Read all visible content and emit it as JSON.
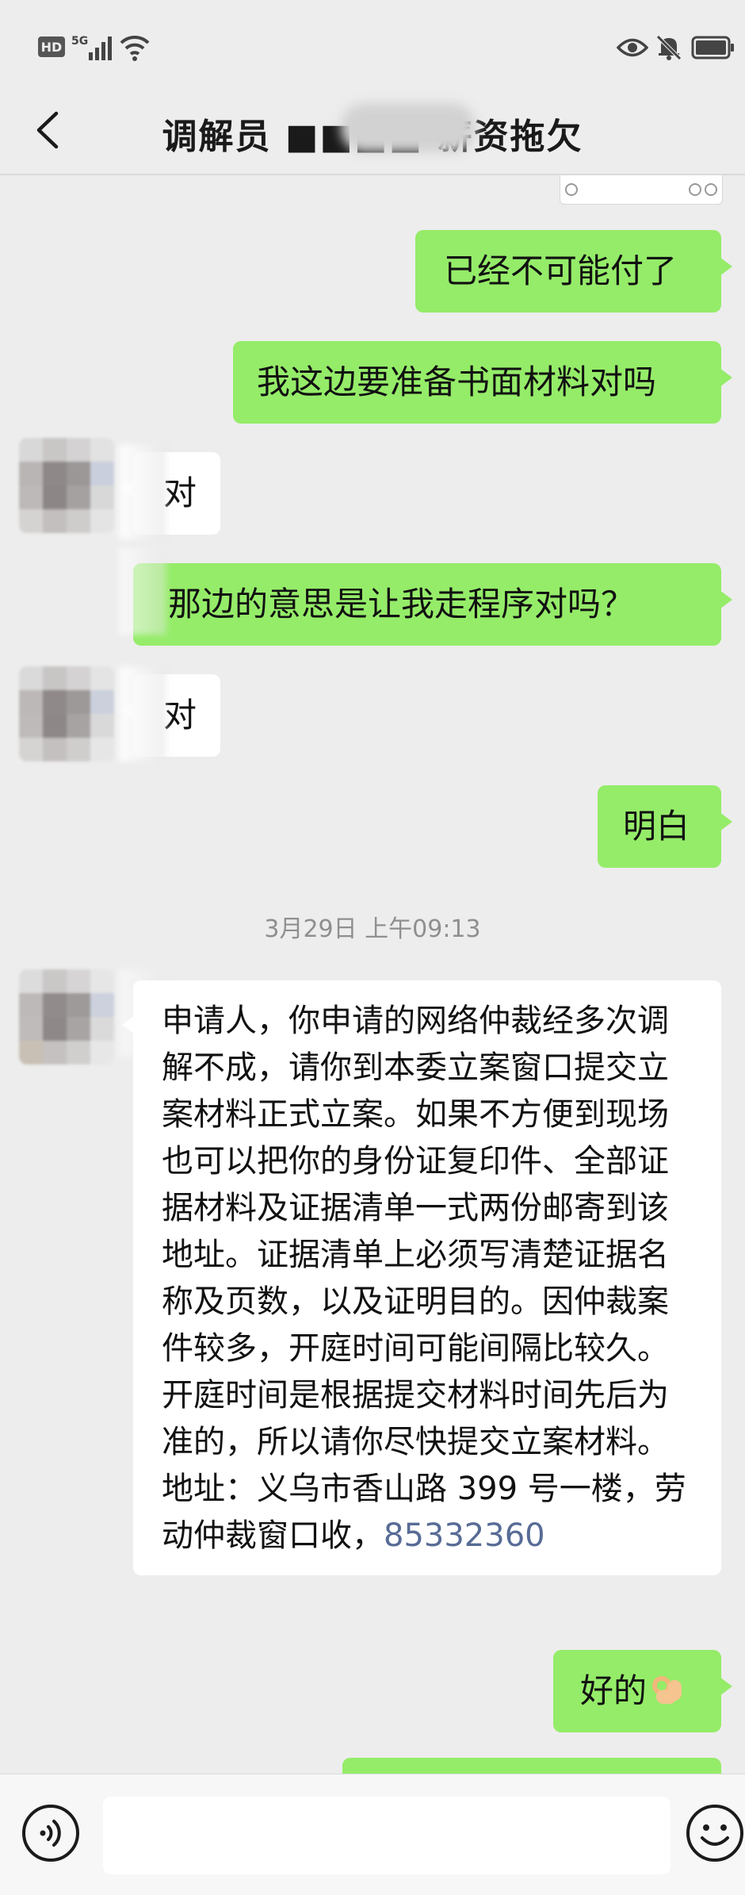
{
  "status_bar": {
    "hd_label": "HD",
    "network_label": "5G",
    "icons": [
      "hd-badge",
      "5g-signal-icon",
      "wifi-icon",
      "eye-icon",
      "mute-bell-icon",
      "battery-icon"
    ]
  },
  "header": {
    "title": "调解员 ■■■■ 薪资拖欠",
    "back_icon": "chevron-left-icon"
  },
  "messages": [
    {
      "side": "out",
      "text": "已经不可能付了"
    },
    {
      "side": "out",
      "text": "我这边要准备书面材料对吗"
    },
    {
      "side": "in",
      "text": "对"
    },
    {
      "side": "out",
      "text": "那边的意思是让我走程序对吗？"
    },
    {
      "side": "in",
      "text": "对"
    },
    {
      "side": "out",
      "text": "明白"
    },
    {
      "side": "in",
      "text": "申请人，你申请的网络仲裁经多次调解不成，请你到本委立案窗口提交立案材料正式立案。如果不方便到现场也可以把你的身份证复印件、全部证据材料及证据清单一式两份邮寄到该地址。证据清单上必须写清楚证据名称及页数，以及证明目的。因仲裁案件较多，开庭时间可能间隔比较久。开庭时间是根据提交材料时间先后为准的，所以请你尽快提交立案材料。地址：义乌市香山路 399 号一楼，劳动仲裁窗口收，",
      "phone": "85332360"
    },
    {
      "side": "out",
      "text": "好的",
      "emoji": "ok-hand-emoji"
    }
  ],
  "timestamp": "3月29日 上午09:13",
  "input_bar": {
    "voice_icon": "voice-input-icon",
    "text_value": "",
    "emoji_icon": "emoji-smiley-icon"
  },
  "colors": {
    "background": "#ededed",
    "outgoing_bubble": "#95ec69",
    "incoming_bubble": "#ffffff",
    "link": "#576b95"
  }
}
